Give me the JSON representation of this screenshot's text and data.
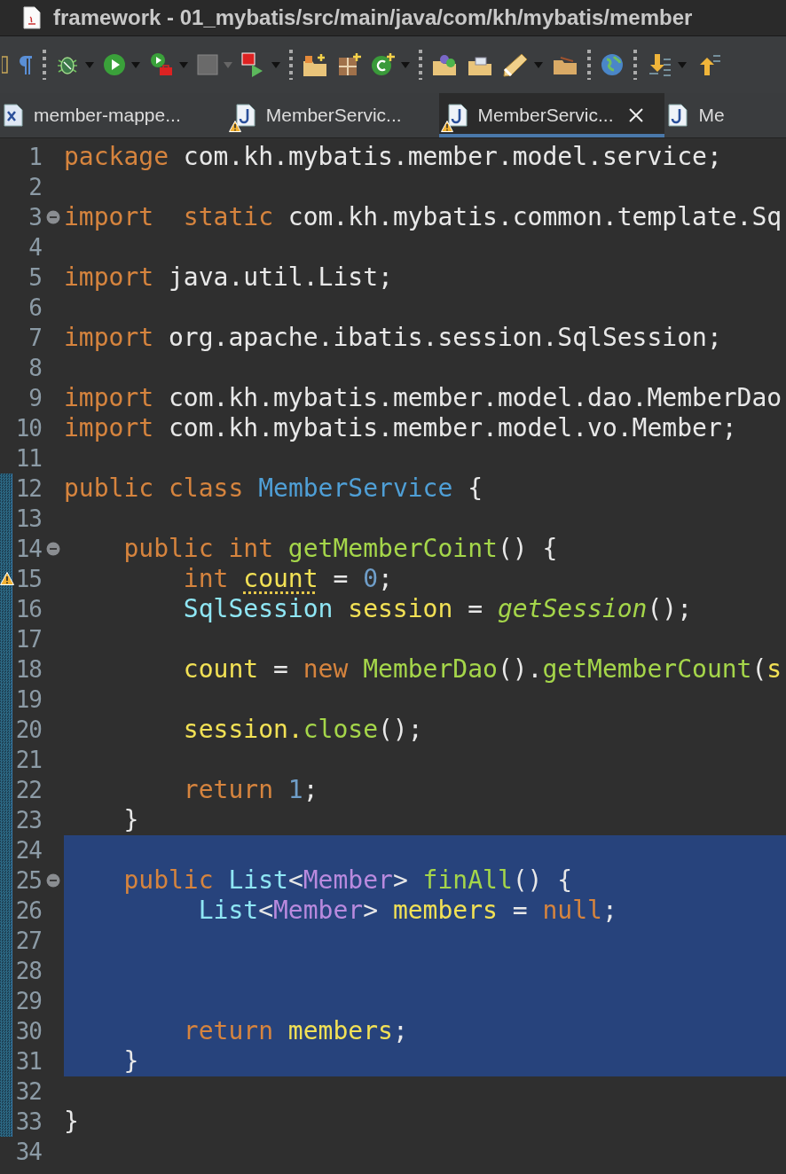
{
  "window": {
    "title": "framework - 01_mybatis/src/main/java/com/kh/mybatis/member"
  },
  "tabs": [
    {
      "label": "member-mappe...",
      "kind": "xml",
      "warning": false,
      "selected": false
    },
    {
      "label": "MemberServic...",
      "kind": "java",
      "warning": true,
      "selected": false
    },
    {
      "label": "MemberServic...",
      "kind": "java",
      "warning": true,
      "selected": true
    },
    {
      "label": "Me",
      "kind": "java",
      "warning": false,
      "selected": false
    }
  ],
  "editor": {
    "lines": [
      {
        "number": "1",
        "fold": false,
        "warning": false,
        "changed": false,
        "selected": false,
        "tokens": [
          {
            "text": "package",
            "kind": "keyword"
          },
          {
            "text": " com.kh.mybatis.member.model.service;",
            "kind": "plain"
          }
        ]
      },
      {
        "number": "2",
        "fold": false,
        "warning": false,
        "changed": false,
        "selected": false
      },
      {
        "number": "3",
        "fold": true,
        "warning": false,
        "changed": false,
        "selected": false,
        "tokens": [
          {
            "text": "import",
            "kind": "keyword"
          },
          {
            "text": "  static",
            "kind": "keyword"
          },
          {
            "text": " com.kh.mybatis.common.template.Sq",
            "kind": "plain"
          }
        ]
      },
      {
        "number": "4",
        "fold": false,
        "warning": false,
        "changed": false,
        "selected": false
      },
      {
        "number": "5",
        "fold": false,
        "warning": false,
        "changed": false,
        "selected": false,
        "tokens": [
          {
            "text": "import",
            "kind": "keyword"
          },
          {
            "text": " java.util.List;",
            "kind": "plain"
          }
        ]
      },
      {
        "number": "6",
        "fold": false,
        "warning": false,
        "changed": false,
        "selected": false
      },
      {
        "number": "7",
        "fold": false,
        "warning": false,
        "changed": false,
        "selected": false,
        "tokens": [
          {
            "text": "import",
            "kind": "keyword"
          },
          {
            "text": " org.apache.ibatis.session.SqlSession;",
            "kind": "plain"
          }
        ]
      },
      {
        "number": "8",
        "fold": false,
        "warning": false,
        "changed": false,
        "selected": false
      },
      {
        "number": "9",
        "fold": false,
        "warning": false,
        "changed": false,
        "selected": false,
        "tokens": [
          {
            "text": "import",
            "kind": "keyword"
          },
          {
            "text": " com.kh.mybatis.member.model.dao.MemberDao",
            "kind": "plain"
          }
        ]
      },
      {
        "number": "10",
        "fold": false,
        "warning": false,
        "changed": false,
        "selected": false,
        "tokens": [
          {
            "text": "import",
            "kind": "keyword"
          },
          {
            "text": " com.kh.mybatis.member.model.vo.Member;",
            "kind": "plain"
          }
        ]
      },
      {
        "number": "11",
        "fold": false,
        "warning": false,
        "changed": false,
        "selected": false
      },
      {
        "number": "12",
        "fold": false,
        "warning": false,
        "changed": true,
        "selected": false,
        "tokens": [
          {
            "text": "public",
            "kind": "keyword"
          },
          {
            "text": " class",
            "kind": "keyword"
          },
          {
            "text": " MemberService",
            "kind": "class"
          },
          {
            "text": " {",
            "kind": "plain"
          }
        ]
      },
      {
        "number": "13",
        "fold": false,
        "warning": false,
        "changed": true,
        "selected": false
      },
      {
        "number": "14",
        "fold": true,
        "warning": false,
        "changed": true,
        "selected": false,
        "tokens": [
          {
            "text": "    public",
            "kind": "keyword"
          },
          {
            "text": " int",
            "kind": "keyword"
          },
          {
            "text": " getMemberCoint",
            "kind": "method"
          },
          {
            "text": "() {",
            "kind": "plain"
          }
        ]
      },
      {
        "number": "15",
        "fold": false,
        "warning": true,
        "changed": true,
        "selected": false,
        "tokens": [
          {
            "text": "        int ",
            "kind": "keyword"
          },
          {
            "text": "count",
            "kind": "variable",
            "warning": true
          },
          {
            "text": " = ",
            "kind": "plain"
          },
          {
            "text": "0",
            "kind": "number"
          },
          {
            "text": ";",
            "kind": "plain"
          }
        ]
      },
      {
        "number": "16",
        "fold": false,
        "warning": false,
        "changed": true,
        "selected": false,
        "tokens": [
          {
            "text": "        SqlSession",
            "kind": "type"
          },
          {
            "text": " session",
            "kind": "variable"
          },
          {
            "text": " = ",
            "kind": "plain"
          },
          {
            "text": "getSession",
            "kind": "static"
          },
          {
            "text": "();",
            "kind": "plain"
          }
        ]
      },
      {
        "number": "17",
        "fold": false,
        "warning": false,
        "changed": true,
        "selected": false
      },
      {
        "number": "18",
        "fold": false,
        "warning": false,
        "changed": true,
        "selected": false,
        "tokens": [
          {
            "text": "        count",
            "kind": "variable"
          },
          {
            "text": " = ",
            "kind": "plain"
          },
          {
            "text": "new",
            "kind": "keyword"
          },
          {
            "text": " MemberDao",
            "kind": "method"
          },
          {
            "text": "().",
            "kind": "plain"
          },
          {
            "text": "getMemberCount",
            "kind": "method"
          },
          {
            "text": "(",
            "kind": "plain"
          },
          {
            "text": "s",
            "kind": "variable"
          }
        ]
      },
      {
        "number": "19",
        "fold": false,
        "warning": false,
        "changed": true,
        "selected": false
      },
      {
        "number": "20",
        "fold": false,
        "warning": false,
        "changed": true,
        "selected": false,
        "tokens": [
          {
            "text": "        session.",
            "kind": "variable"
          },
          {
            "text": "close",
            "kind": "method"
          },
          {
            "text": "();",
            "kind": "plain"
          }
        ]
      },
      {
        "number": "21",
        "fold": false,
        "warning": false,
        "changed": true,
        "selected": false
      },
      {
        "number": "22",
        "fold": false,
        "warning": false,
        "changed": true,
        "selected": false,
        "tokens": [
          {
            "text": "        return",
            "kind": "keyword"
          },
          {
            "text": " 1",
            "kind": "number"
          },
          {
            "text": ";",
            "kind": "plain"
          }
        ]
      },
      {
        "number": "23",
        "fold": false,
        "warning": false,
        "changed": true,
        "selected": false,
        "tokens": [
          {
            "text": "    }",
            "kind": "plain"
          }
        ]
      },
      {
        "number": "24",
        "fold": false,
        "warning": false,
        "changed": true,
        "selected": true
      },
      {
        "number": "25",
        "fold": true,
        "warning": false,
        "changed": true,
        "selected": true,
        "tokens": [
          {
            "text": "    public",
            "kind": "keyword"
          },
          {
            "text": " List",
            "kind": "type"
          },
          {
            "text": "<",
            "kind": "plain"
          },
          {
            "text": "Member",
            "kind": "generic"
          },
          {
            "text": "> ",
            "kind": "plain"
          },
          {
            "text": "finAll",
            "kind": "method"
          },
          {
            "text": "() {",
            "kind": "plain"
          }
        ]
      },
      {
        "number": "26",
        "fold": false,
        "warning": false,
        "changed": true,
        "selected": true,
        "tokens": [
          {
            "text": "         List",
            "kind": "type"
          },
          {
            "text": "<",
            "kind": "plain"
          },
          {
            "text": "Member",
            "kind": "generic"
          },
          {
            "text": "> ",
            "kind": "plain"
          },
          {
            "text": "members",
            "kind": "variable"
          },
          {
            "text": " = ",
            "kind": "plain"
          },
          {
            "text": "null",
            "kind": "keyword"
          },
          {
            "text": ";",
            "kind": "plain"
          }
        ]
      },
      {
        "number": "27",
        "fold": false,
        "warning": false,
        "changed": true,
        "selected": true
      },
      {
        "number": "28",
        "fold": false,
        "warning": false,
        "changed": true,
        "selected": true
      },
      {
        "number": "29",
        "fold": false,
        "warning": false,
        "changed": true,
        "selected": true
      },
      {
        "number": "30",
        "fold": false,
        "warning": false,
        "changed": true,
        "selected": true,
        "tokens": [
          {
            "text": "        return",
            "kind": "keyword"
          },
          {
            "text": " members",
            "kind": "variable"
          },
          {
            "text": ";",
            "kind": "plain"
          }
        ]
      },
      {
        "number": "31",
        "fold": false,
        "warning": false,
        "changed": true,
        "selected": true,
        "tokens": [
          {
            "text": "    }",
            "kind": "plain"
          }
        ]
      },
      {
        "number": "32",
        "fold": false,
        "warning": false,
        "changed": true,
        "selected": false
      },
      {
        "number": "33",
        "fold": false,
        "warning": false,
        "changed": true,
        "selected": false,
        "tokens": [
          {
            "text": "}",
            "kind": "plain"
          }
        ]
      },
      {
        "number": "34",
        "fold": false,
        "warning": false,
        "changed": false,
        "selected": false
      }
    ]
  }
}
